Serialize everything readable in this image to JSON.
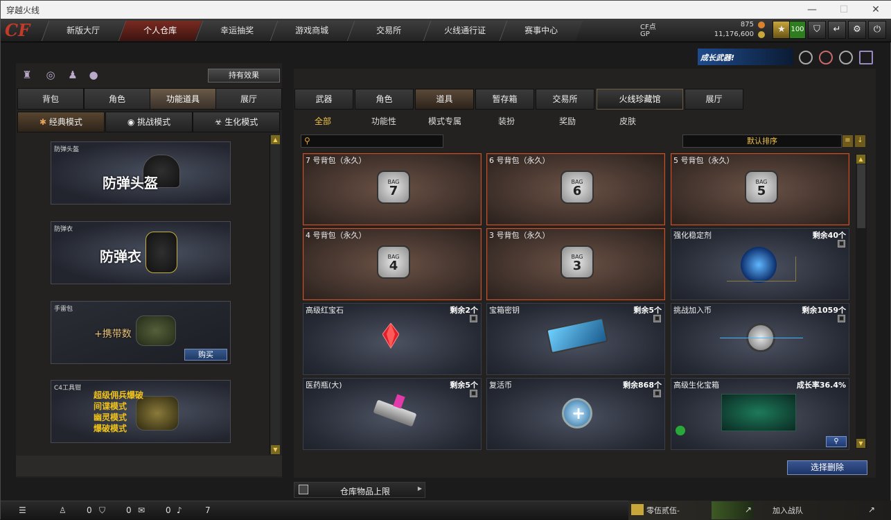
{
  "window": {
    "title": "穿越火线"
  },
  "nav": {
    "logo": "CF",
    "tabs": [
      "新版大厅",
      "个人仓库",
      "幸运抽奖",
      "游戏商城",
      "交易所",
      "火线通行证",
      "赛事中心"
    ]
  },
  "currency": {
    "cf_label": "CF点",
    "cf_value": "875",
    "gp_label": "GP",
    "gp_value": "11,176,600",
    "level": "100"
  },
  "promo": {
    "text": "成长武器!"
  },
  "left": {
    "effect_button": "持有效果",
    "tabs": [
      "背包",
      "角色",
      "功能道具",
      "展厅"
    ],
    "modes": [
      "经典模式",
      "挑战模式",
      "生化模式"
    ],
    "cards": [
      {
        "caption": "防弹头盔",
        "title": "防弹头盔"
      },
      {
        "caption": "防弹衣",
        "title": "防弹衣"
      },
      {
        "caption": "手雷包",
        "title": "+携带数",
        "button": "购买"
      },
      {
        "caption": "C4工具钳",
        "lines": [
          "超级佣兵爆破",
          "间谍模式",
          "幽灵模式",
          "爆破模式"
        ]
      }
    ]
  },
  "right": {
    "tabs": [
      "武器",
      "角色",
      "道具",
      "暂存箱",
      "交易所",
      "火线珍藏馆",
      "展厅"
    ],
    "subtabs": [
      "全部",
      "功能性",
      "模式专属",
      "装扮",
      "奖励",
      "皮肤"
    ],
    "sort_label": "默认排序",
    "items": [
      {
        "name": "7 号背包（永久）",
        "remain": "",
        "type": "bag",
        "num": "7"
      },
      {
        "name": "6 号背包（永久）",
        "remain": "",
        "type": "bag",
        "num": "6"
      },
      {
        "name": "5 号背包（永久）",
        "remain": "",
        "type": "bag",
        "num": "5"
      },
      {
        "name": "4 号背包（永久）",
        "remain": "",
        "type": "bag",
        "num": "4"
      },
      {
        "name": "3 号背包（永久）",
        "remain": "",
        "type": "bag",
        "num": "3"
      },
      {
        "name": "强化稳定剂",
        "remain": "剩余40个",
        "type": "stabilizer"
      },
      {
        "name": "高级红宝石",
        "remain": "剩余2个",
        "type": "ruby"
      },
      {
        "name": "宝箱密钥",
        "remain": "剩余5个",
        "type": "key"
      },
      {
        "name": "挑战加入币",
        "remain": "剩余1059个",
        "type": "coin"
      },
      {
        "name": "医药瓶(大)",
        "remain": "剩余5个",
        "type": "gun"
      },
      {
        "name": "复活币",
        "remain": "剩余868个",
        "type": "revive"
      },
      {
        "name": "高级生化宝箱",
        "remain": "成长率36.4%",
        "type": "box"
      }
    ],
    "bag_label": "BAG",
    "delete_button": "选择删除",
    "limit_label": "仓库物品上限"
  },
  "status": {
    "count1": "0",
    "count2": "0",
    "count3": "0",
    "count4": "7"
  },
  "team": {
    "name": "零伍贰伍-",
    "join": "加入战队"
  }
}
